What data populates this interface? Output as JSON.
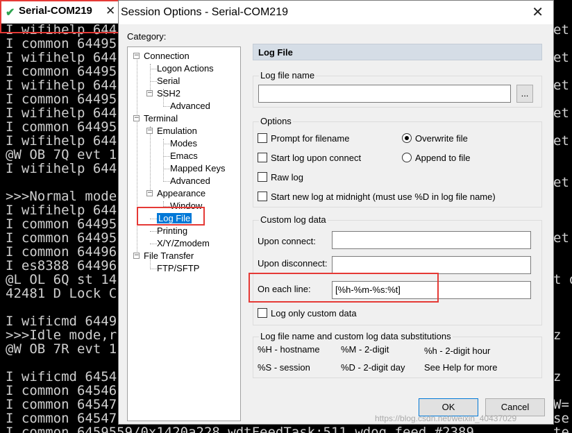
{
  "terminal": {
    "tab_title": "Serial-COM219",
    "lines": [
      "I wifihelp 644",
      "I common 64495",
      "I wifihelp 644",
      "I common 64495",
      "I wifihelp 644",
      "I common 64495",
      "I wifihelp 644",
      "I common 64495",
      "I wifihelp 644",
      "@W OB 7Q evt 1",
      "I wifihelp 644",
      "",
      ">>>Normal mode",
      "I wifihelp 644",
      "I common 64495",
      "I common 64495",
      "I common 64496",
      "I es8388 64496",
      "@L OL 6Q st 14",
      "42481 D Lock C",
      "",
      "I wificmd 6449",
      ">>>Idle mode,r",
      "@W OB 7R evt 1",
      "",
      "I wificmd 6454",
      "I common 64546",
      "I common 64547",
      "I common 64547",
      "I common 6459559/0x1420a228 wdtFeedTask:511 wdog feed #2389"
    ],
    "right_lines": [
      "et",
      "",
      "et",
      "",
      "et",
      "",
      "et",
      "",
      "et",
      "",
      "",
      "et",
      "",
      "",
      "",
      "et",
      "",
      "",
      "t o",
      "",
      "",
      "",
      "z",
      "",
      "",
      "z",
      "",
      "W=",
      "se",
      "te",
      "us"
    ]
  },
  "dialog": {
    "title": "Session Options - Serial-COM219",
    "category_label": "Category:",
    "tree": [
      {
        "label": "Connection",
        "expander": "−"
      },
      {
        "label": "Logon Actions"
      },
      {
        "label": "Serial"
      },
      {
        "label": "SSH2",
        "expander": "−"
      },
      {
        "label": "Advanced"
      },
      {
        "label": "Terminal",
        "expander": "−"
      },
      {
        "label": "Emulation",
        "expander": "−"
      },
      {
        "label": "Modes"
      },
      {
        "label": "Emacs"
      },
      {
        "label": "Mapped Keys"
      },
      {
        "label": "Advanced"
      },
      {
        "label": "Appearance",
        "expander": "−"
      },
      {
        "label": "Window"
      },
      {
        "label": "Log File",
        "selected": true
      },
      {
        "label": "Printing"
      },
      {
        "label": "X/Y/Zmodem"
      },
      {
        "label": "File Transfer",
        "expander": "−"
      },
      {
        "label": "FTP/SFTP"
      }
    ],
    "panel_header": "Log File",
    "log_file_name": {
      "label": "Log file name",
      "value": "",
      "browse_label": "..."
    },
    "options": {
      "label": "Options",
      "prompt_filename": "Prompt for filename",
      "start_on_connect": "Start log upon connect",
      "raw_log": "Raw log",
      "new_log_midnight": "Start new log at midnight (must use %D in log file name)",
      "overwrite": "Overwrite file",
      "append": "Append to file"
    },
    "custom": {
      "label": "Custom log data",
      "upon_connect": "Upon connect:",
      "upon_disconnect": "Upon disconnect:",
      "on_each_line": "On each line:",
      "on_each_line_value": "[%h-%m-%s:%t]",
      "log_only_custom": "Log only custom data"
    },
    "subs": {
      "label": "Log file name and custom log data substitutions",
      "items": [
        "%H - hostname",
        "%M - 2-digit",
        "%h - 2-digit hour",
        "%S - session",
        "%D - 2-digit day",
        "See Help for more"
      ]
    },
    "ok_label": "OK",
    "cancel_label": "Cancel"
  },
  "watermark": "https://blog.csdn.net/weixin_40437029",
  "colors": {
    "highlight": "#e53935",
    "selection": "#0078d7"
  }
}
